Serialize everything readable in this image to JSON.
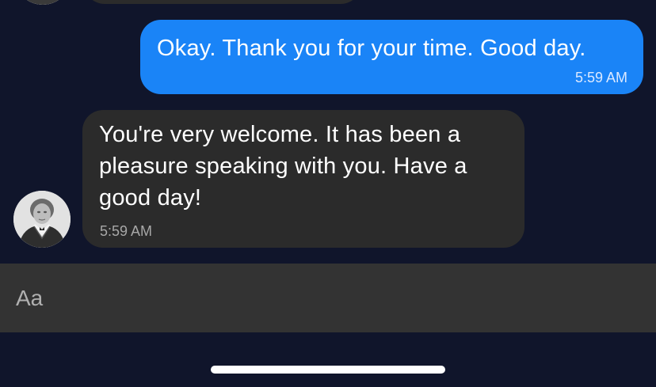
{
  "conversation": {
    "messages": [
      {
        "direction": "outgoing",
        "text": "Okay. Thank you for your time. Good day.",
        "time": "5:59 AM"
      },
      {
        "direction": "incoming",
        "text": "You're very welcome. It has been a pleasure speaking with you. Have a good day!",
        "time": "5:59 AM"
      }
    ],
    "contact_avatar_icon": "portrait-avatar-icon"
  },
  "composer": {
    "placeholder": "Aa"
  },
  "colors": {
    "background": "#10152b",
    "outgoing_bubble": "#1a84f7",
    "incoming_bubble": "#2b2b2b",
    "composer_bar": "#333333"
  }
}
